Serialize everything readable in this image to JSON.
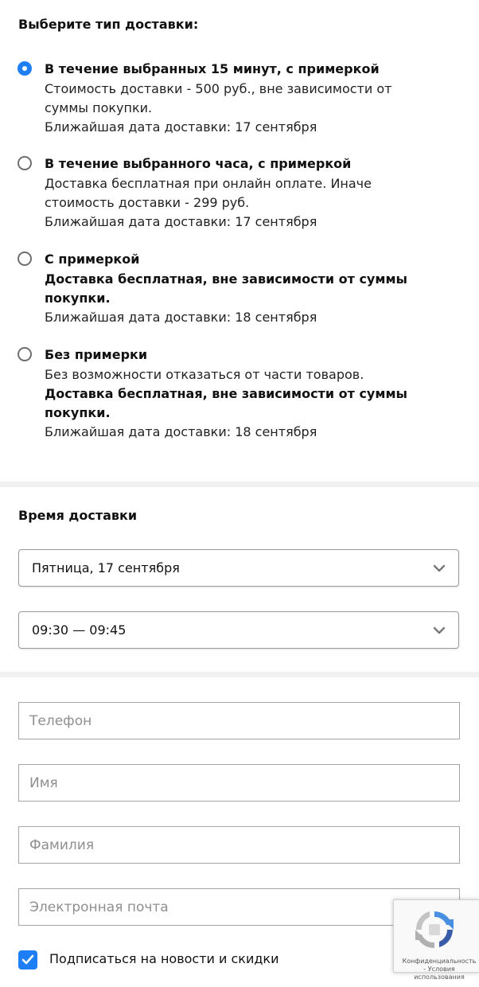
{
  "delivery_type": {
    "title": "Выберите тип доставки:",
    "options": [
      {
        "title": "В течение выбранных 15 минут, с примеркой",
        "line1": "Стоимость доставки - 500 руб., вне зависимости от",
        "line2": "суммы покупки.",
        "date": "Ближайшая дата доставки: 17 сентября",
        "selected": true
      },
      {
        "title": "В течение выбранного часа, с примеркой",
        "line1": "Доставка бесплатная при онлайн оплате. Иначе",
        "line2": "стоимость доставки - 299 руб.",
        "date": "Ближайшая дата доставки: 17 сентября",
        "selected": false
      },
      {
        "title": "С примеркой",
        "line1": "Доставка бесплатная, вне зависимости от суммы",
        "line2": "покупки.",
        "date": "Ближайшая дата доставки: 18 сентября",
        "selected": false
      },
      {
        "title": "Без примерки",
        "line0": "Без возможности отказаться от части товаров.",
        "line1": "Доставка бесплатная, вне зависимости от суммы",
        "line2": "покупки.",
        "date": "Ближайшая дата доставки: 18 сентября",
        "selected": false
      }
    ]
  },
  "delivery_time": {
    "title": "Время доставки",
    "date_select": "Пятница, 17 сентября",
    "time_select": "09:30 — 09:45"
  },
  "contact_form": {
    "phone_placeholder": "Телефон",
    "first_name_placeholder": "Имя",
    "last_name_placeholder": "Фамилия",
    "email_placeholder": "Электронная почта"
  },
  "subscribe": {
    "label": "Подписаться на новости и скидки",
    "checked": true
  },
  "recaptcha": {
    "links": "Конфиденциальность - Условия использования"
  },
  "colors": {
    "accent": "#1e7ef5",
    "separator": "#f1f1f1",
    "placeholder": "#8f8f8f"
  }
}
